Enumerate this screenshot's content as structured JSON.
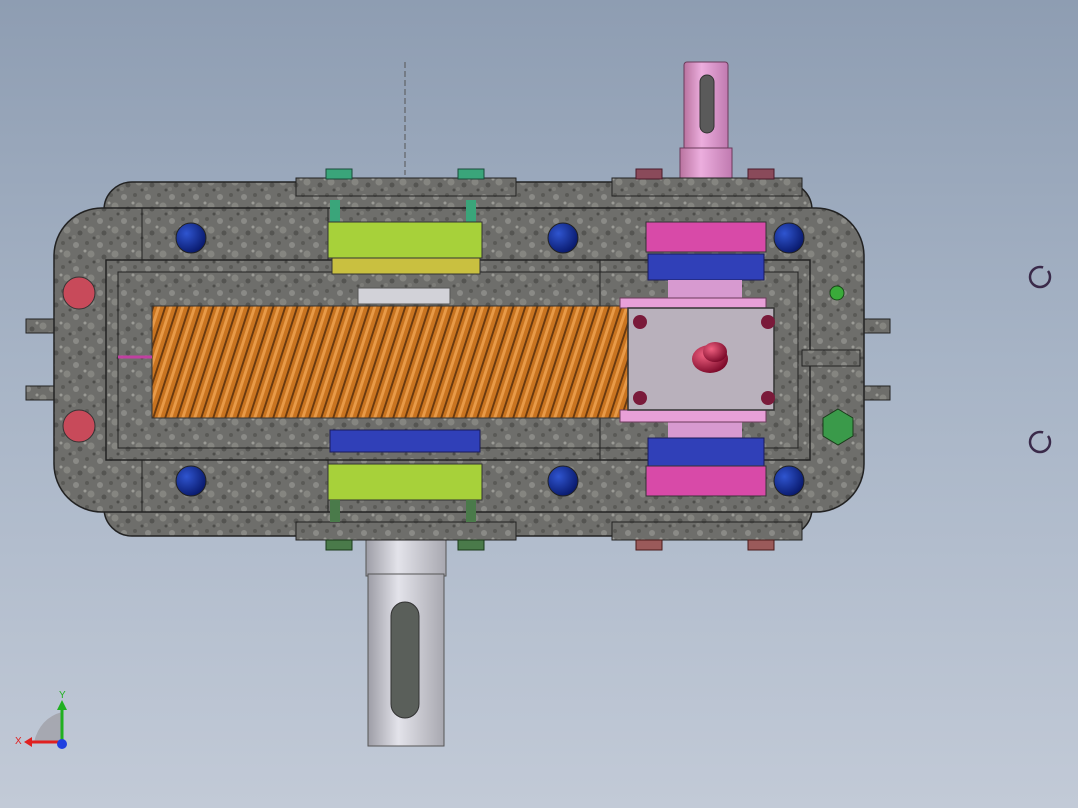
{
  "viewport": {
    "background_top": "#8e9db2",
    "background_bottom": "#c2cad7"
  },
  "model": {
    "housing_color": "#6f6f6c",
    "worm_color": "#d9842a",
    "bearing_green": "#a7d13a",
    "bearing_magenta": "#d84aa8",
    "bolt_blue": "#0d2a8a",
    "plug_red": "#c84a5a",
    "plug_green": "#3a9a4a",
    "output_shaft_color": "#d79ad0",
    "input_shaft_color": "#c9c9cf",
    "cover_plate_color": "#b9b1bc",
    "knob_color": "#b01040"
  },
  "triad": {
    "x_label": "X",
    "y_label": "Y",
    "x_color": "#e02020",
    "y_color": "#20b020",
    "z_color": "#2040e0"
  },
  "view_indicators": [
    {
      "name": "view-indicator-top",
      "icon": "circle-arrow-icon"
    },
    {
      "name": "view-indicator-bottom",
      "icon": "circle-arrow-icon"
    }
  ]
}
